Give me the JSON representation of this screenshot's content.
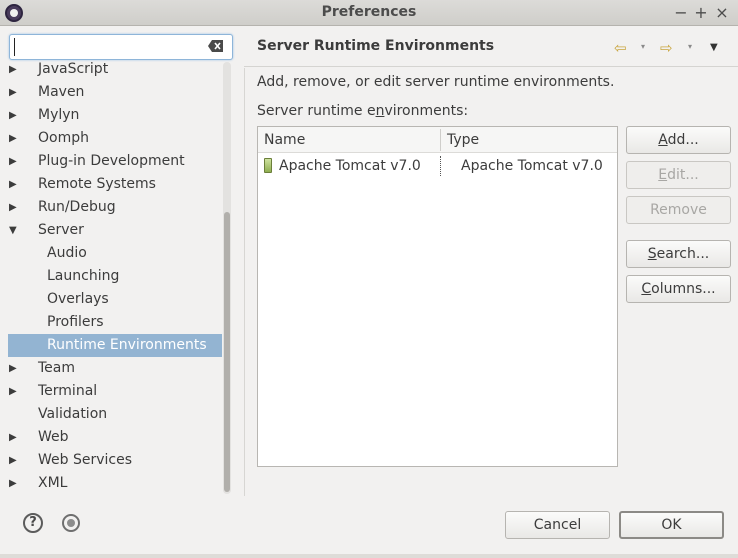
{
  "window": {
    "title": "Preferences",
    "controls": [
      "−",
      "+",
      "×"
    ]
  },
  "search": {
    "value": "",
    "placeholder": ""
  },
  "tree": {
    "items": [
      {
        "label": "JavaScript",
        "level": 0,
        "expandable": true,
        "expanded": false
      },
      {
        "label": "Maven",
        "level": 0,
        "expandable": true,
        "expanded": false
      },
      {
        "label": "Mylyn",
        "level": 0,
        "expandable": true,
        "expanded": false
      },
      {
        "label": "Oomph",
        "level": 0,
        "expandable": true,
        "expanded": false
      },
      {
        "label": "Plug-in Development",
        "level": 0,
        "expandable": true,
        "expanded": false
      },
      {
        "label": "Remote Systems",
        "level": 0,
        "expandable": true,
        "expanded": false
      },
      {
        "label": "Run/Debug",
        "level": 0,
        "expandable": true,
        "expanded": false
      },
      {
        "label": "Server",
        "level": 0,
        "expandable": true,
        "expanded": true
      },
      {
        "label": "Audio",
        "level": 1,
        "expandable": false
      },
      {
        "label": "Launching",
        "level": 1,
        "expandable": false
      },
      {
        "label": "Overlays",
        "level": 1,
        "expandable": false
      },
      {
        "label": "Profilers",
        "level": 1,
        "expandable": false
      },
      {
        "label": "Runtime Environments",
        "level": 1,
        "expandable": false,
        "selected": true
      },
      {
        "label": "Team",
        "level": 0,
        "expandable": true,
        "expanded": false
      },
      {
        "label": "Terminal",
        "level": 0,
        "expandable": true,
        "expanded": false
      },
      {
        "label": "Validation",
        "level": 0,
        "expandable": false
      },
      {
        "label": "Web",
        "level": 0,
        "expandable": true,
        "expanded": false
      },
      {
        "label": "Web Services",
        "level": 0,
        "expandable": true,
        "expanded": false
      },
      {
        "label": "XML",
        "level": 0,
        "expandable": true,
        "expanded": false
      }
    ]
  },
  "page": {
    "title": "Server Runtime Environments",
    "description": "Add, remove, or edit server runtime environments.",
    "list_label_pre": "Server runtime e",
    "list_label_mnemonic": "n",
    "list_label_post": "vironments:",
    "nav": {
      "back": "⇦",
      "forward": "⇨",
      "dropdown": "▾",
      "menu": "▼"
    }
  },
  "table": {
    "columns": [
      "Name",
      "Type"
    ],
    "rows": [
      {
        "name": "Apache Tomcat v7.0",
        "type": "Apache Tomcat v7.0"
      }
    ]
  },
  "buttons": {
    "add": {
      "pre": "",
      "u": "A",
      "post": "dd..."
    },
    "edit": {
      "pre": "",
      "u": "E",
      "post": "dit..."
    },
    "remove": {
      "pre": "Remove",
      "u": "",
      "post": ""
    },
    "search": {
      "pre": "",
      "u": "S",
      "post": "earch..."
    },
    "columns": {
      "pre": "",
      "u": "C",
      "post": "olumns..."
    }
  },
  "footer": {
    "cancel": "Cancel",
    "ok": "OK",
    "help_glyph": "?"
  },
  "colors": {
    "selection": "#93b4d2",
    "nav_arrows": "#c9a640"
  }
}
